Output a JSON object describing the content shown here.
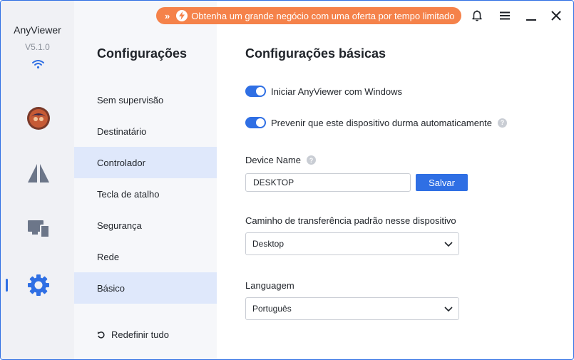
{
  "app": {
    "name": "AnyViewer",
    "version": "V5.1.0"
  },
  "rail": {
    "icons": [
      "avatar",
      "connect-icon",
      "devices-icon",
      "settings-icon"
    ],
    "active": "settings-icon"
  },
  "topbar": {
    "promo_text": "Obtenha um grande negócio com uma oferta por tempo limitado",
    "icons": [
      "bell-icon",
      "menu-icon",
      "minimize-icon",
      "close-icon"
    ]
  },
  "nav": {
    "title": "Configurações",
    "items": [
      {
        "label": "Sem supervisão"
      },
      {
        "label": "Destinatário"
      },
      {
        "label": "Controlador"
      },
      {
        "label": "Tecla de atalho"
      },
      {
        "label": "Segurança"
      },
      {
        "label": "Rede"
      },
      {
        "label": "Básico"
      }
    ],
    "reset_label": "Redefinir tudo"
  },
  "main": {
    "title": "Configurações básicas",
    "toggle_start": {
      "label": "Iniciar AnyViewer com Windows",
      "on": true
    },
    "toggle_sleep": {
      "label": "Prevenir que este dispositivo durma automaticamente",
      "on": true
    },
    "device_name": {
      "label": "Device Name",
      "value": "DESKTOP",
      "save_label": "Salvar"
    },
    "transfer_path": {
      "label": "Caminho de transferência padrão nesse dispositivo",
      "value": "Desktop"
    },
    "language": {
      "label": "Languagem",
      "value": "Português"
    }
  },
  "colors": {
    "accent": "#2f6fe4",
    "promo": "#f5824a",
    "nav_selected": "#dfe8fb"
  }
}
